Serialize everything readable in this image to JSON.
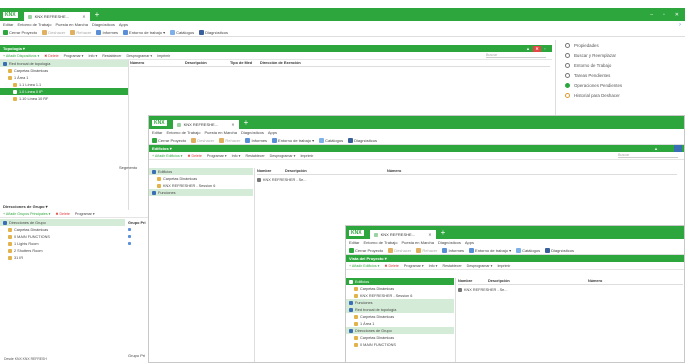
{
  "win1": {
    "tab_title": "KNX REFRESHE...",
    "menu": [
      "Editar",
      "Entorno de Trabajo",
      "Puesta en Marcha",
      "Diagnósticos",
      "Apps"
    ],
    "toolbar": [
      {
        "label": "Cerrar Proyecto",
        "icon": "close-project-icon",
        "disabled": false
      },
      {
        "label": "Deshacer",
        "icon": "undo-icon",
        "disabled": true
      },
      {
        "label": "Rehacer",
        "icon": "redo-icon",
        "disabled": true
      },
      {
        "label": "Informes",
        "icon": "reports-icon",
        "disabled": false
      },
      {
        "label": "Entorno de trabajo ▾",
        "icon": "workspace-icon",
        "disabled": false
      },
      {
        "label": "Catálogos",
        "icon": "catalog-icon",
        "disabled": false
      },
      {
        "label": "Diagnósticos",
        "icon": "diagnostics-icon",
        "disabled": false
      }
    ],
    "panel_title": "Topología ▾",
    "nav": [
      "+ Añadir Dispositivos ▾",
      "✖ Delete",
      "Programar ▾",
      "Info ▾",
      "Restablecer",
      "Desprogramar ▾",
      "Imprimir"
    ],
    "search_placeholder": "Buscar",
    "tree": [
      {
        "label": "Red troncal de topología",
        "indent": 0,
        "state": "hl"
      },
      {
        "label": "Carpetas Dinámicas",
        "indent": 1,
        "state": ""
      },
      {
        "label": "1 Área 1",
        "indent": 1,
        "state": ""
      },
      {
        "label": "1.1 Línea 1.1",
        "indent": 2,
        "state": ""
      },
      {
        "label": "1.0 Línea 0 IP",
        "indent": 2,
        "state": "sel"
      },
      {
        "label": "1.10 Línea 10 RF",
        "indent": 2,
        "state": ""
      }
    ],
    "columns": [
      "Número",
      "Descripción",
      "Tipo de Med",
      "Dirección de Exención"
    ],
    "properties": [
      {
        "label": "Propiedades",
        "icon": "properties-icon"
      },
      {
        "label": "Buscar y Reemplazar",
        "icon": "find-replace-icon"
      },
      {
        "label": "Entorno de Trabajo",
        "icon": "workspace-icon"
      },
      {
        "label": "Tareas Pendientes",
        "icon": "todo-icon"
      },
      {
        "label": "Operaciones Pendientes",
        "icon": "pending-ops-icon"
      },
      {
        "label": "Historial para Deshacer",
        "icon": "undo-history-icon"
      }
    ],
    "group_panel_title": "Direcciones de Grupo ▾",
    "group_nav": [
      "+ Añadir Grupos Principales ▾",
      "✖ Delete",
      "Programar ▾"
    ],
    "group_tree": [
      {
        "label": "Direcciones de Grupo",
        "indent": 0,
        "state": "hl"
      },
      {
        "label": "Carpetas Dinámicas",
        "indent": 1,
        "state": ""
      },
      {
        "label": "0 MAIN FUNCTIONS",
        "indent": 1,
        "state": ""
      },
      {
        "label": "1 Lights Room",
        "indent": 1,
        "state": ""
      },
      {
        "label": "2 Shutters Room",
        "indent": 1,
        "state": ""
      },
      {
        "label": "31 IR",
        "indent": 1,
        "state": ""
      }
    ],
    "group_col": "Grupo Pri",
    "segment_label": "Segmento",
    "grupo_pri_label": "Grupo Pri",
    "status": "Desde KNX KNX REFRESH"
  },
  "win2": {
    "tab_title": "KNX REFRESHE...",
    "menu": [
      "Editar",
      "Entorno de Trabajo",
      "Puesta en Marcha",
      "Diagnósticos",
      "Apps"
    ],
    "toolbar": [
      "Cerrar Proyecto",
      "Deshacer",
      "Rehacer",
      "Informes",
      "Entorno de trabajo ▾",
      "Catálogos",
      "Diagnósticos"
    ],
    "panel_title": "Edificios ▾",
    "nav": [
      "+ Añadir Edificios ▾",
      "✖ Delete",
      "Programar ▾",
      "Info ▾",
      "Restablecer",
      "Desprogramar ▾",
      "Imprimir"
    ],
    "search_placeholder": "Buscar",
    "tree": [
      {
        "label": "Edificios",
        "indent": 0,
        "state": "hl"
      },
      {
        "label": "Carpetas Dinámicas",
        "indent": 1,
        "state": ""
      },
      {
        "label": "KNX REFRESHER - Session 6",
        "indent": 1,
        "state": ""
      },
      {
        "label": "Funciones",
        "indent": 0,
        "state": "hl"
      }
    ],
    "columns": [
      "Nombre",
      "Descripción",
      "Número"
    ],
    "row": "KNX REFRESHER - Se..."
  },
  "win3": {
    "tab_title": "KNX REFRESHE...",
    "menu": [
      "Editar",
      "Entorno de Trabajo",
      "Puesta en Marcha",
      "Diagnósticos",
      "Apps"
    ],
    "toolbar": [
      "Cerrar Proyecto",
      "Deshacer",
      "Rehacer",
      "Informes",
      "Entorno de trabajo ▾",
      "Catálogos",
      "Diagnósticos"
    ],
    "panel_title": "Vista del Proyecto ▾",
    "nav": [
      "+ Añadir Edificios ▾",
      "✖ Delete",
      "Programar ▾",
      "Info ▾",
      "Restablecer",
      "Desprogramar ▾",
      "Imprimir"
    ],
    "tree": [
      {
        "label": "Edificios",
        "indent": 0,
        "state": "sel"
      },
      {
        "label": "Carpetas Dinámicas",
        "indent": 1,
        "state": ""
      },
      {
        "label": "KNX REFRESHER - Session 6",
        "indent": 1,
        "state": ""
      },
      {
        "label": "Funciones",
        "indent": 0,
        "state": "hl"
      },
      {
        "label": "Red troncal de topología",
        "indent": 0,
        "state": "hl"
      },
      {
        "label": "Carpetas Dinámicas",
        "indent": 1,
        "state": ""
      },
      {
        "label": "1 Área 1",
        "indent": 1,
        "state": ""
      },
      {
        "label": "Direcciones de Grupo",
        "indent": 0,
        "state": "hl"
      },
      {
        "label": "Carpetas Dinámicas",
        "indent": 1,
        "state": ""
      },
      {
        "label": "0 MAIN FUNCTIONS",
        "indent": 1,
        "state": ""
      }
    ],
    "columns": [
      "Nombre",
      "Descripción",
      "Número"
    ],
    "row": "KNX REFRESHER - Se..."
  },
  "colors": {
    "knx_green": "#2da63e",
    "highlight": "#d4ecd7"
  }
}
